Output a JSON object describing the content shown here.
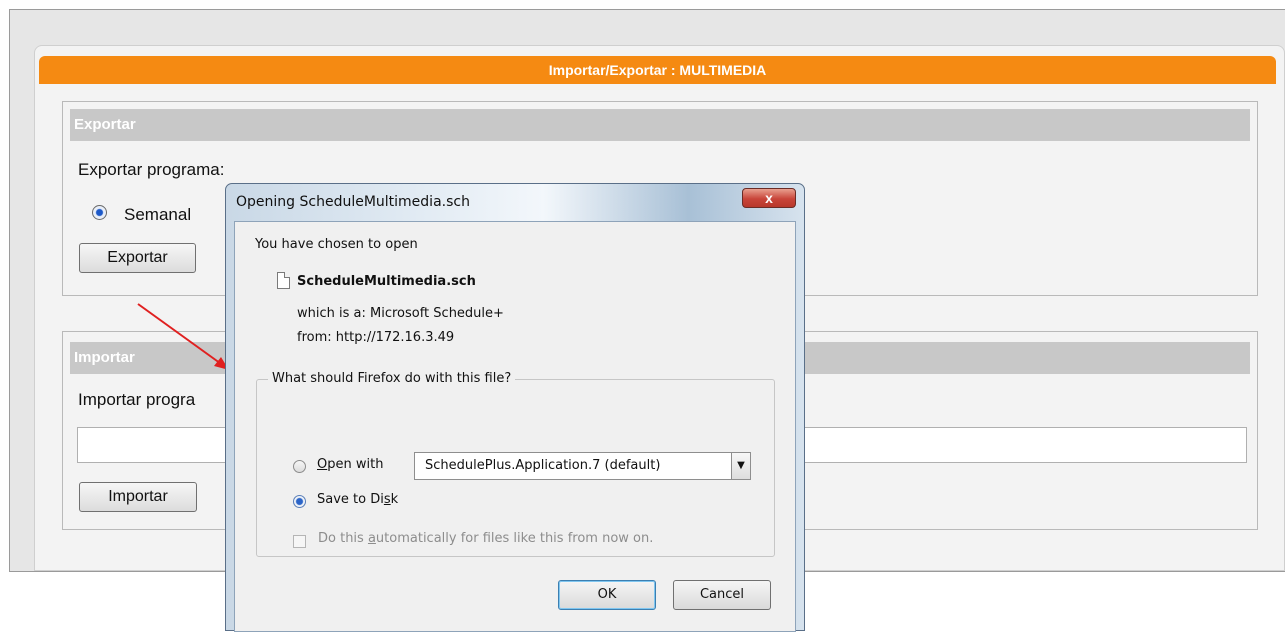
{
  "page": {
    "panel_title": "Importar/Exportar : MULTIMEDIA",
    "export": {
      "section_title": "Exportar",
      "program_label": "Exportar programa:",
      "radio_label": "Semanal",
      "button_label": "Exportar"
    },
    "import": {
      "section_title": "Importar",
      "program_label": "Importar progra",
      "input_value": "",
      "button_label": "Importar"
    }
  },
  "dialog": {
    "title": "Opening ScheduleMultimedia.sch",
    "close_label": "x",
    "intro": "You have chosen to open",
    "file_name": "ScheduleMultimedia.sch",
    "type_line": "which is a:  Microsoft Schedule+",
    "from_line": "from:  http://172.16.3.49",
    "group_legend": "What should Firefox do with this file?",
    "open_with_label": "Open with",
    "open_with_underline": "O",
    "open_with_rest": "pen with",
    "open_with_app": "SchedulePlus.Application.7 (default)",
    "save_label_pre": "Save to Di",
    "save_label_u": "s",
    "save_label_post": "k",
    "auto_pre": "Do this ",
    "auto_u": "a",
    "auto_post": "utomatically for files like this from now on.",
    "ok_label": "OK",
    "cancel_label": "Cancel"
  },
  "colors": {
    "header": "#f58a12",
    "section_title_bg": "#c8c8c8",
    "arrow": "#e02020"
  }
}
